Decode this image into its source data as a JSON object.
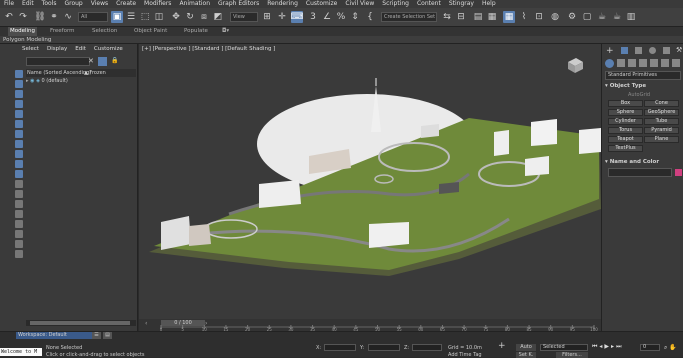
{
  "menu": [
    "File",
    "Edit",
    "Tools",
    "Group",
    "Views",
    "Create",
    "Modifiers",
    "Animation",
    "Graph Editors",
    "Rendering",
    "Customize",
    "Civil View",
    "Scripting",
    "Content",
    "Civil View",
    "Help"
  ],
  "menu_real": [
    "File",
    "Edit",
    "Tools",
    "Group",
    "Views",
    "Create",
    "Modifiers",
    "Animation",
    "Graph Editors",
    "Rendering",
    "Customize",
    "Civil View",
    "Scripting",
    "Content",
    "Stingray",
    "Help"
  ],
  "toolbar": {
    "filter_select": "All",
    "view_select": "View",
    "selection_set": "Create Selection Set"
  },
  "ribbon": {
    "tabs": [
      "Modeling",
      "Freeform",
      "Selection",
      "Object Paint",
      "Populate"
    ],
    "panel": "Polygon Modeling"
  },
  "scene_explorer": {
    "menu": [
      "Select",
      "Display",
      "Edit",
      "Customize"
    ],
    "col1": "Name (Sorted Ascending)",
    "col2": "▲ Frozen",
    "row1": "0 (default)"
  },
  "viewport": {
    "label": "[+] [Perspective ] [Standard ] [Default Shading ]"
  },
  "command_panel": {
    "category": "Standard Primitives",
    "object_type_title": "Object Type",
    "autogrid": "AutoGrid",
    "buttons": [
      "Box",
      "Cone",
      "Sphere",
      "GeoSphere",
      "Cylinder",
      "Tube",
      "Torus",
      "Pyramid",
      "Teapot",
      "Plane",
      "TextPlus"
    ],
    "name_color_title": "Name and Color"
  },
  "timeline": {
    "frame": "0 / 100",
    "ticks": [
      "0",
      "5",
      "10",
      "15",
      "20",
      "25",
      "30",
      "35",
      "40",
      "45",
      "50",
      "55",
      "60",
      "65",
      "70",
      "75",
      "80",
      "85",
      "90",
      "95",
      "100"
    ]
  },
  "status": {
    "workspace": "Workspace: Default",
    "selected": "None Selected",
    "welcome": "Welcome to M",
    "prompt": "Click or click-and-drag to select objects",
    "x": "X:",
    "y": "Y:",
    "z": "Z:",
    "grid": "Grid = 10.0m",
    "add_time_tag": "Add Time Tag",
    "auto": "Auto",
    "selected_mode": "Selected",
    "set_key": "Set K.",
    "filters": "Filters...",
    "frame_value": "0"
  }
}
